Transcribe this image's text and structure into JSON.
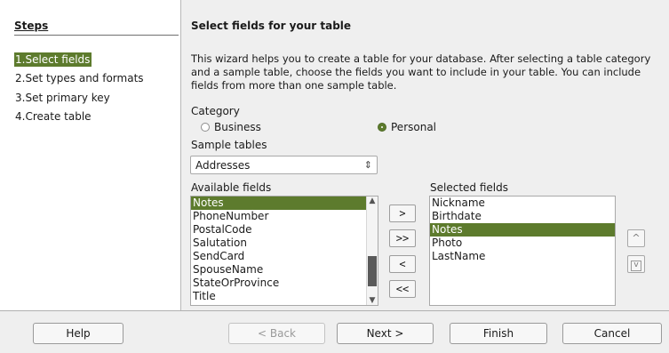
{
  "steps": {
    "title": "Steps",
    "items": [
      {
        "label": "1.Select fields",
        "active": true
      },
      {
        "label": "2.Set types and formats",
        "active": false
      },
      {
        "label": "3.Set primary key",
        "active": false
      },
      {
        "label": "4.Create table",
        "active": false
      }
    ]
  },
  "main": {
    "title": "Select fields for your table",
    "intro": "This wizard helps you to create a table for your database. After selecting a table category and a sample table, choose the fields you want to include in your table. You can include fields from more than one sample table.",
    "category_label": "Category",
    "category_options": [
      {
        "label": "Business",
        "checked": false
      },
      {
        "label": "Personal",
        "checked": true
      }
    ],
    "sample_tables_label": "Sample tables",
    "sample_table_value": "Addresses",
    "available_label": "Available fields",
    "available_fields": [
      "Notes",
      "PhoneNumber",
      "PostalCode",
      "Salutation",
      "SendCard",
      "SpouseName",
      "StateOrProvince",
      "Title"
    ],
    "available_selected_index": 0,
    "selected_label": "Selected fields",
    "selected_fields": [
      "Nickname",
      "Birthdate",
      "Notes",
      "Photo",
      "LastName"
    ],
    "selected_selected_index": 2,
    "move_buttons": [
      ">",
      ">>",
      "<",
      "<<"
    ],
    "order_up": "^",
    "order_down": "v"
  },
  "footer": {
    "help": "Help",
    "back": "< Back",
    "next": "Next >",
    "finish": "Finish",
    "cancel": "Cancel"
  },
  "colors": {
    "accent": "#5d7b2d",
    "panel": "#efefef"
  }
}
